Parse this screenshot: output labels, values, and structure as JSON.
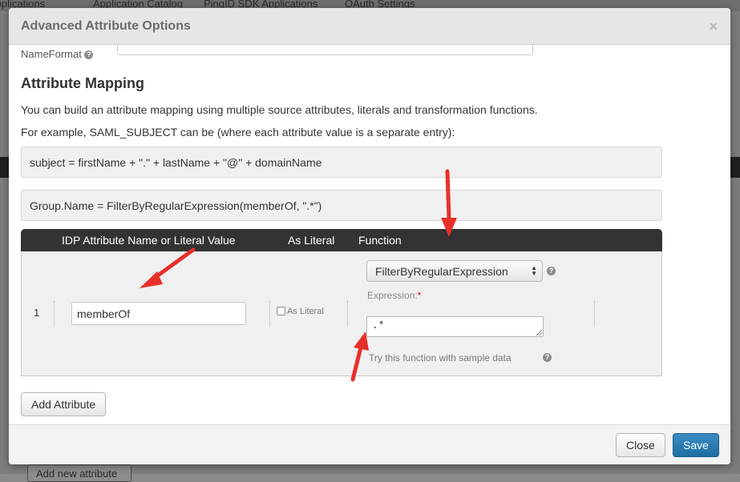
{
  "background": {
    "tabs": [
      "Applications",
      "Application Catalog",
      "PingID SDK Applications",
      "OAuth Settings"
    ],
    "add_new_attribute_label": "Add new attribute"
  },
  "modal": {
    "title": "Advanced Attribute Options",
    "close_glyph": "×",
    "nameformat_label": "NameFormat",
    "section_title": "Attribute Mapping",
    "intro_text": "You can build an attribute mapping using multiple source attributes, literals and transformation functions.",
    "example_intro": "For example, SAML_SUBJECT can be (where each attribute value is a separate entry):",
    "examples": [
      "subject = firstName + \".\" + lastName + \"@\" + domainName",
      "Group.Name = FilterByRegularExpression(memberOf, \".*\")"
    ],
    "table": {
      "headers": {
        "idp_attribute": "IDP Attribute Name or Literal Value",
        "as_literal": "As Literal",
        "function": "Function"
      },
      "rows": [
        {
          "index": "1",
          "attribute_value": "memberOf",
          "as_literal_label": "As Literal",
          "as_literal_checked": false,
          "function_selected": "FilterByRegularExpression",
          "expression_label": "Expression:",
          "required_mark": "*",
          "expression_value": ".*",
          "try_link": "Try this function with sample data"
        }
      ]
    },
    "add_attribute_label": "Add Attribute",
    "footer": {
      "close_label": "Close",
      "save_label": "Save"
    }
  },
  "colors": {
    "header_bg": "#e6e6e6",
    "table_header_bg": "#333333",
    "primary_button": "#1f6ea3",
    "annotation_arrow": "#e8302a"
  },
  "icons": [
    "help-icon",
    "close-icon",
    "select-arrows-icon",
    "annotation-arrow-icon"
  ]
}
